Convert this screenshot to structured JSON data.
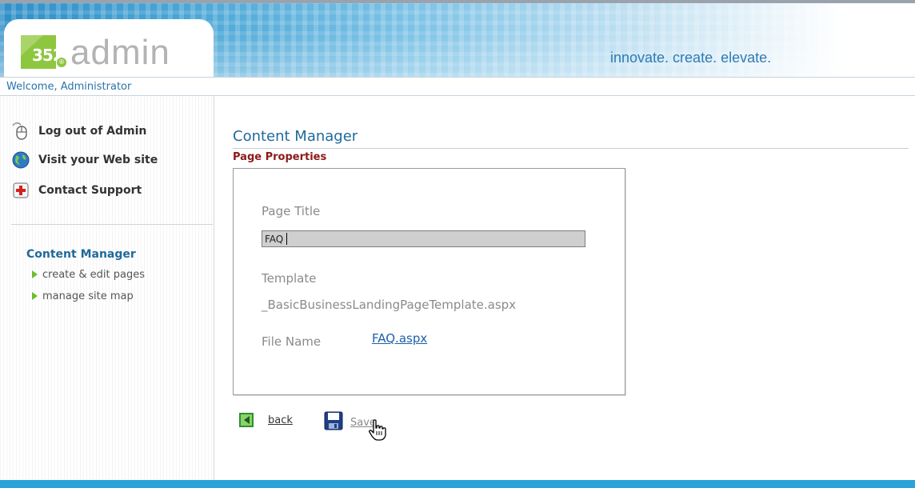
{
  "header": {
    "logo_number": "352",
    "logo_registered": "®",
    "logo_word": "admin",
    "tagline": "innovate. create. elevate."
  },
  "welcome": "Welcome, Administrator",
  "sidebar": {
    "links": [
      {
        "label": "Log out of Admin",
        "icon": "mouse-icon"
      },
      {
        "label": "Visit your Web site",
        "icon": "globe-icon"
      },
      {
        "label": "Contact Support",
        "icon": "support-cross-icon"
      }
    ],
    "nav_title": "Content Manager",
    "nav_items": [
      "create & edit pages",
      "manage site map"
    ]
  },
  "main": {
    "title": "Content Manager",
    "section": "Page Properties",
    "page_title_label": "Page Title",
    "page_title_value": "FAQ",
    "template_label": "Template",
    "template_value": "_BasicBusinessLandingPageTemplate.aspx",
    "file_name_label": "File Name",
    "file_name_value": "FAQ.aspx"
  },
  "actions": {
    "back_label": "back",
    "save_label": "Save"
  },
  "colors": {
    "accent": "#1f6a9c",
    "section_title": "#8b1a1a",
    "logo_green": "#8dc63f",
    "footer": "#2aa3d8"
  }
}
